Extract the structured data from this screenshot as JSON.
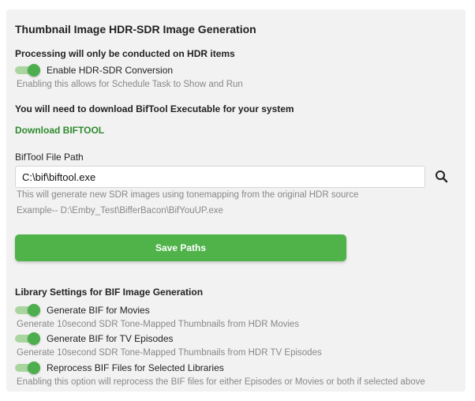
{
  "section_title": "Thumbnail Image HDR-SDR Image Generation",
  "processing_note": "Processing will only be conducted on HDR items",
  "hdr_sdr_toggle": {
    "label": "Enable HDR-SDR Conversion",
    "enabled": true,
    "help": "Enabling this allows for Schedule Task to Show and Run"
  },
  "download_note": "You will need to download BifTool Executable for your system",
  "download_link": "Download BIFTOOL",
  "biftool_path": {
    "label": "BifTool File Path",
    "value": "C:\\bif\\biftool.exe",
    "help1": "This will generate new SDR images using tonemapping from the original HDR source",
    "help2": "Example-- D:\\Emby_Test\\BifferBacon\\BifYouUP.exe",
    "search_icon": "search-icon"
  },
  "save_button": "Save Paths",
  "library_settings": {
    "title": "Library Settings for BIF Image Generation",
    "items": [
      {
        "label": "Generate BIF for Movies",
        "enabled": true,
        "help": "Generate 10second SDR Tone-Mapped Thumbnails from HDR Movies"
      },
      {
        "label": "Generate BIF for TV Episodes",
        "enabled": true,
        "help": "Generate 10second SDR Tone-Mapped Thumbnails from HDR TV Episodes"
      },
      {
        "label": "Reprocess BIF Files for Selected Libraries",
        "enabled": true,
        "help": "Enabling this option will reprocess the BIF files for either Episodes or Movies or both if selected above"
      }
    ]
  },
  "colors": {
    "accent": "#4fb34a",
    "link": "#2e8b2e",
    "toggle_track": "#a9d59f",
    "toggle_knob": "#4cae4c"
  }
}
